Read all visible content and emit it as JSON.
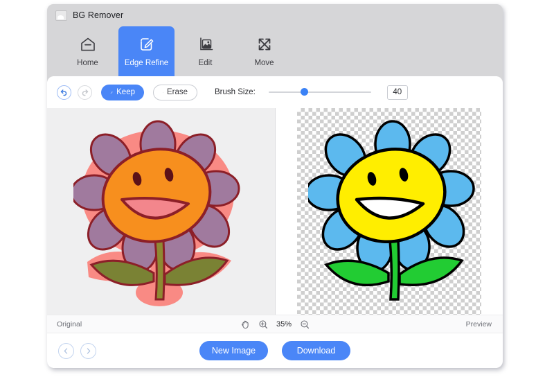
{
  "window": {
    "title": "BG Remover",
    "app_icon": "image-icon"
  },
  "nav": {
    "items": [
      {
        "label": "Home",
        "icon": "home-icon",
        "active": false
      },
      {
        "label": "Edge Refine",
        "icon": "edge-refine-icon",
        "active": true
      },
      {
        "label": "Edit",
        "icon": "edit-image-icon",
        "active": false
      },
      {
        "label": "Move",
        "icon": "move-icon",
        "active": false
      }
    ]
  },
  "toolbar": {
    "undo_icon": "undo-icon",
    "redo_icon": "redo-icon",
    "undo_enabled": true,
    "redo_enabled": false,
    "keep_label": "Keep",
    "keep_icon": "brush-keep-icon",
    "erase_label": "Erase",
    "erase_icon": "brush-erase-icon",
    "brush_size_label": "Brush Size:",
    "brush_size_value": "40",
    "brush_slider_percent": 31
  },
  "canvas": {
    "original_label": "Original",
    "preview_label": "Preview",
    "hand_tool_icon": "hand-icon",
    "zoom_in_icon": "zoom-in-icon",
    "zoom_out_icon": "zoom-out-icon",
    "zoom_level": "35%"
  },
  "actions": {
    "prev_icon": "chevron-left-icon",
    "next_icon": "chevron-right-icon",
    "new_image_label": "New Image",
    "download_label": "Download"
  },
  "colors": {
    "accent": "#4a86f7",
    "title_bar": "#d6d6d8",
    "canvas_bg": "#efeff0",
    "mask_overlay": "#f98a84",
    "original_face": "#f78f1e",
    "original_petal": "#a07a9e",
    "original_outline": "#8c1f28",
    "preview_face": "#ffee00",
    "preview_petal": "#5cb9ee",
    "preview_leaf": "#22cc33",
    "preview_outline": "#000000"
  }
}
